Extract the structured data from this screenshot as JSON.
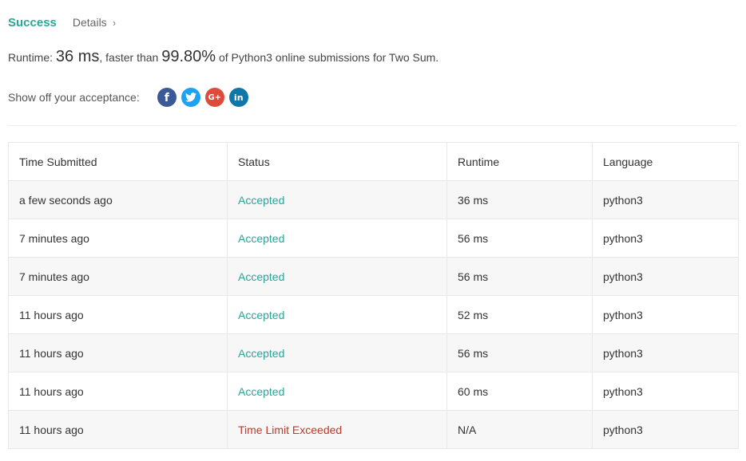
{
  "header": {
    "status": "Success",
    "details_label": "Details",
    "chevron": "›"
  },
  "runtime_line": {
    "prefix": "Runtime: ",
    "runtime": "36 ms",
    "middle": ", faster than ",
    "percent": "99.80%",
    "suffix": " of Python3 online submissions for Two Sum."
  },
  "share": {
    "label": "Show off your acceptance:",
    "buttons": [
      {
        "icon": "facebook-icon",
        "glyph": "f",
        "color": "#3b5998"
      },
      {
        "icon": "twitter-icon",
        "glyph": "",
        "color": "#1da1f2"
      },
      {
        "icon": "google-plus-icon",
        "glyph": "G+",
        "color": "#dd4b39"
      },
      {
        "icon": "linkedin-icon",
        "glyph": "in",
        "color": "#0e76a8"
      }
    ]
  },
  "table": {
    "columns": [
      "Time Submitted",
      "Status",
      "Runtime",
      "Language"
    ],
    "rows": [
      {
        "time": "a few seconds ago",
        "status": "Accepted",
        "runtime": "36 ms",
        "language": "python3"
      },
      {
        "time": "7 minutes ago",
        "status": "Accepted",
        "runtime": "56 ms",
        "language": "python3"
      },
      {
        "time": "7 minutes ago",
        "status": "Accepted",
        "runtime": "56 ms",
        "language": "python3"
      },
      {
        "time": "11 hours ago",
        "status": "Accepted",
        "runtime": "52 ms",
        "language": "python3"
      },
      {
        "time": "11 hours ago",
        "status": "Accepted",
        "runtime": "56 ms",
        "language": "python3"
      },
      {
        "time": "11 hours ago",
        "status": "Accepted",
        "runtime": "60 ms",
        "language": "python3"
      },
      {
        "time": "11 hours ago",
        "status": "Time Limit Exceeded",
        "runtime": "N/A",
        "language": "python3"
      }
    ]
  },
  "colors": {
    "accent": "#2ba597",
    "error": "#c0392b"
  }
}
